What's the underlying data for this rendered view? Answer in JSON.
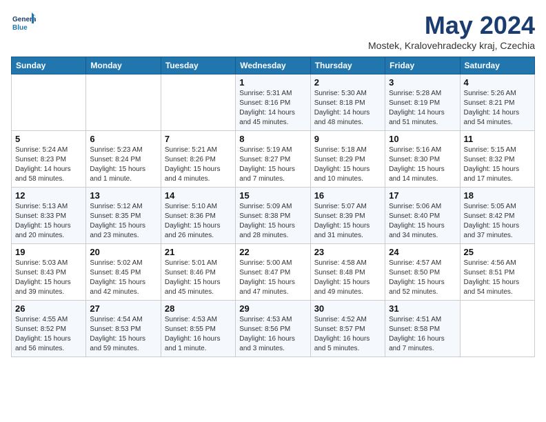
{
  "logo": {
    "line1": "General",
    "line2": "Blue"
  },
  "title": "May 2024",
  "location": "Mostek, Kralovehradecky kraj, Czechia",
  "days_of_week": [
    "Sunday",
    "Monday",
    "Tuesday",
    "Wednesday",
    "Thursday",
    "Friday",
    "Saturday"
  ],
  "weeks": [
    [
      {
        "day": "",
        "info": ""
      },
      {
        "day": "",
        "info": ""
      },
      {
        "day": "",
        "info": ""
      },
      {
        "day": "1",
        "info": "Sunrise: 5:31 AM\nSunset: 8:16 PM\nDaylight: 14 hours\nand 45 minutes."
      },
      {
        "day": "2",
        "info": "Sunrise: 5:30 AM\nSunset: 8:18 PM\nDaylight: 14 hours\nand 48 minutes."
      },
      {
        "day": "3",
        "info": "Sunrise: 5:28 AM\nSunset: 8:19 PM\nDaylight: 14 hours\nand 51 minutes."
      },
      {
        "day": "4",
        "info": "Sunrise: 5:26 AM\nSunset: 8:21 PM\nDaylight: 14 hours\nand 54 minutes."
      }
    ],
    [
      {
        "day": "5",
        "info": "Sunrise: 5:24 AM\nSunset: 8:23 PM\nDaylight: 14 hours\nand 58 minutes."
      },
      {
        "day": "6",
        "info": "Sunrise: 5:23 AM\nSunset: 8:24 PM\nDaylight: 15 hours\nand 1 minute."
      },
      {
        "day": "7",
        "info": "Sunrise: 5:21 AM\nSunset: 8:26 PM\nDaylight: 15 hours\nand 4 minutes."
      },
      {
        "day": "8",
        "info": "Sunrise: 5:19 AM\nSunset: 8:27 PM\nDaylight: 15 hours\nand 7 minutes."
      },
      {
        "day": "9",
        "info": "Sunrise: 5:18 AM\nSunset: 8:29 PM\nDaylight: 15 hours\nand 10 minutes."
      },
      {
        "day": "10",
        "info": "Sunrise: 5:16 AM\nSunset: 8:30 PM\nDaylight: 15 hours\nand 14 minutes."
      },
      {
        "day": "11",
        "info": "Sunrise: 5:15 AM\nSunset: 8:32 PM\nDaylight: 15 hours\nand 17 minutes."
      }
    ],
    [
      {
        "day": "12",
        "info": "Sunrise: 5:13 AM\nSunset: 8:33 PM\nDaylight: 15 hours\nand 20 minutes."
      },
      {
        "day": "13",
        "info": "Sunrise: 5:12 AM\nSunset: 8:35 PM\nDaylight: 15 hours\nand 23 minutes."
      },
      {
        "day": "14",
        "info": "Sunrise: 5:10 AM\nSunset: 8:36 PM\nDaylight: 15 hours\nand 26 minutes."
      },
      {
        "day": "15",
        "info": "Sunrise: 5:09 AM\nSunset: 8:38 PM\nDaylight: 15 hours\nand 28 minutes."
      },
      {
        "day": "16",
        "info": "Sunrise: 5:07 AM\nSunset: 8:39 PM\nDaylight: 15 hours\nand 31 minutes."
      },
      {
        "day": "17",
        "info": "Sunrise: 5:06 AM\nSunset: 8:40 PM\nDaylight: 15 hours\nand 34 minutes."
      },
      {
        "day": "18",
        "info": "Sunrise: 5:05 AM\nSunset: 8:42 PM\nDaylight: 15 hours\nand 37 minutes."
      }
    ],
    [
      {
        "day": "19",
        "info": "Sunrise: 5:03 AM\nSunset: 8:43 PM\nDaylight: 15 hours\nand 39 minutes."
      },
      {
        "day": "20",
        "info": "Sunrise: 5:02 AM\nSunset: 8:45 PM\nDaylight: 15 hours\nand 42 minutes."
      },
      {
        "day": "21",
        "info": "Sunrise: 5:01 AM\nSunset: 8:46 PM\nDaylight: 15 hours\nand 45 minutes."
      },
      {
        "day": "22",
        "info": "Sunrise: 5:00 AM\nSunset: 8:47 PM\nDaylight: 15 hours\nand 47 minutes."
      },
      {
        "day": "23",
        "info": "Sunrise: 4:58 AM\nSunset: 8:48 PM\nDaylight: 15 hours\nand 49 minutes."
      },
      {
        "day": "24",
        "info": "Sunrise: 4:57 AM\nSunset: 8:50 PM\nDaylight: 15 hours\nand 52 minutes."
      },
      {
        "day": "25",
        "info": "Sunrise: 4:56 AM\nSunset: 8:51 PM\nDaylight: 15 hours\nand 54 minutes."
      }
    ],
    [
      {
        "day": "26",
        "info": "Sunrise: 4:55 AM\nSunset: 8:52 PM\nDaylight: 15 hours\nand 56 minutes."
      },
      {
        "day": "27",
        "info": "Sunrise: 4:54 AM\nSunset: 8:53 PM\nDaylight: 15 hours\nand 59 minutes."
      },
      {
        "day": "28",
        "info": "Sunrise: 4:53 AM\nSunset: 8:55 PM\nDaylight: 16 hours\nand 1 minute."
      },
      {
        "day": "29",
        "info": "Sunrise: 4:53 AM\nSunset: 8:56 PM\nDaylight: 16 hours\nand 3 minutes."
      },
      {
        "day": "30",
        "info": "Sunrise: 4:52 AM\nSunset: 8:57 PM\nDaylight: 16 hours\nand 5 minutes."
      },
      {
        "day": "31",
        "info": "Sunrise: 4:51 AM\nSunset: 8:58 PM\nDaylight: 16 hours\nand 7 minutes."
      },
      {
        "day": "",
        "info": ""
      }
    ]
  ]
}
